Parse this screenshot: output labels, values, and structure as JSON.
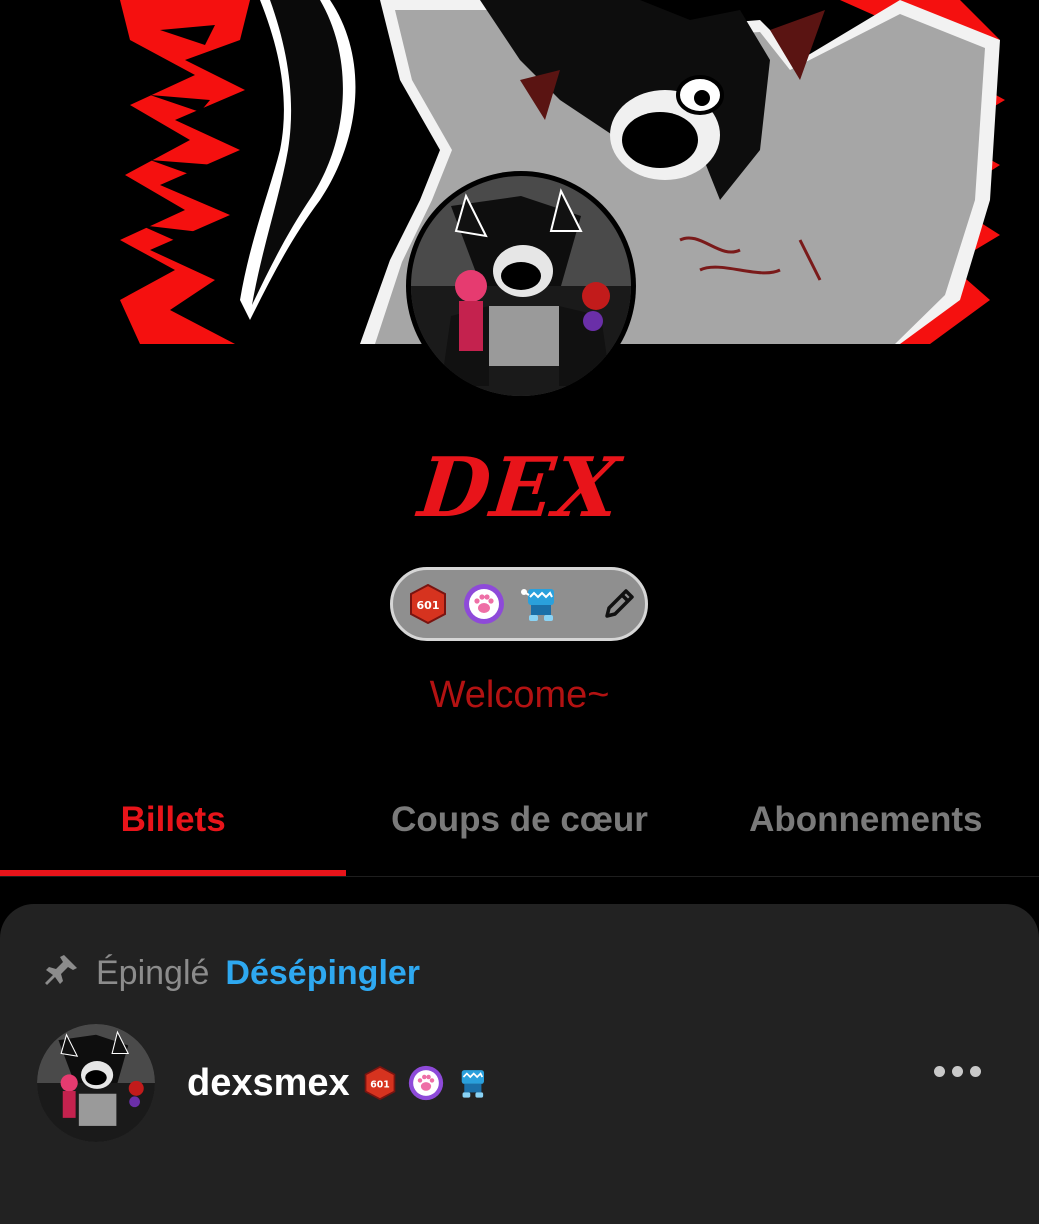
{
  "header": {
    "banner_image": "red-black-character-art-banner",
    "avatar_image": "dex-avatar",
    "title": "DEX",
    "description": "Welcome~",
    "badges": [
      "badge-601-icon",
      "paw-badge-icon",
      "blue-robot-badge-icon"
    ],
    "edit_icon": "pencil-icon"
  },
  "tabs": [
    {
      "label": "Billets",
      "active": true
    },
    {
      "label": "Coups de cœur",
      "active": false
    },
    {
      "label": "Abonnements",
      "active": false
    }
  ],
  "post": {
    "pinned_label": "Épinglé",
    "unpin_label": "Désépingler",
    "username": "dexsmex",
    "badges": [
      "badge-601-icon",
      "paw-badge-icon",
      "blue-robot-badge-icon"
    ],
    "more_icon": "ellipsis-icon"
  },
  "colors": {
    "accent": "#e8141a",
    "link": "#2ea8f0",
    "background": "#000000",
    "card": "#222222"
  }
}
